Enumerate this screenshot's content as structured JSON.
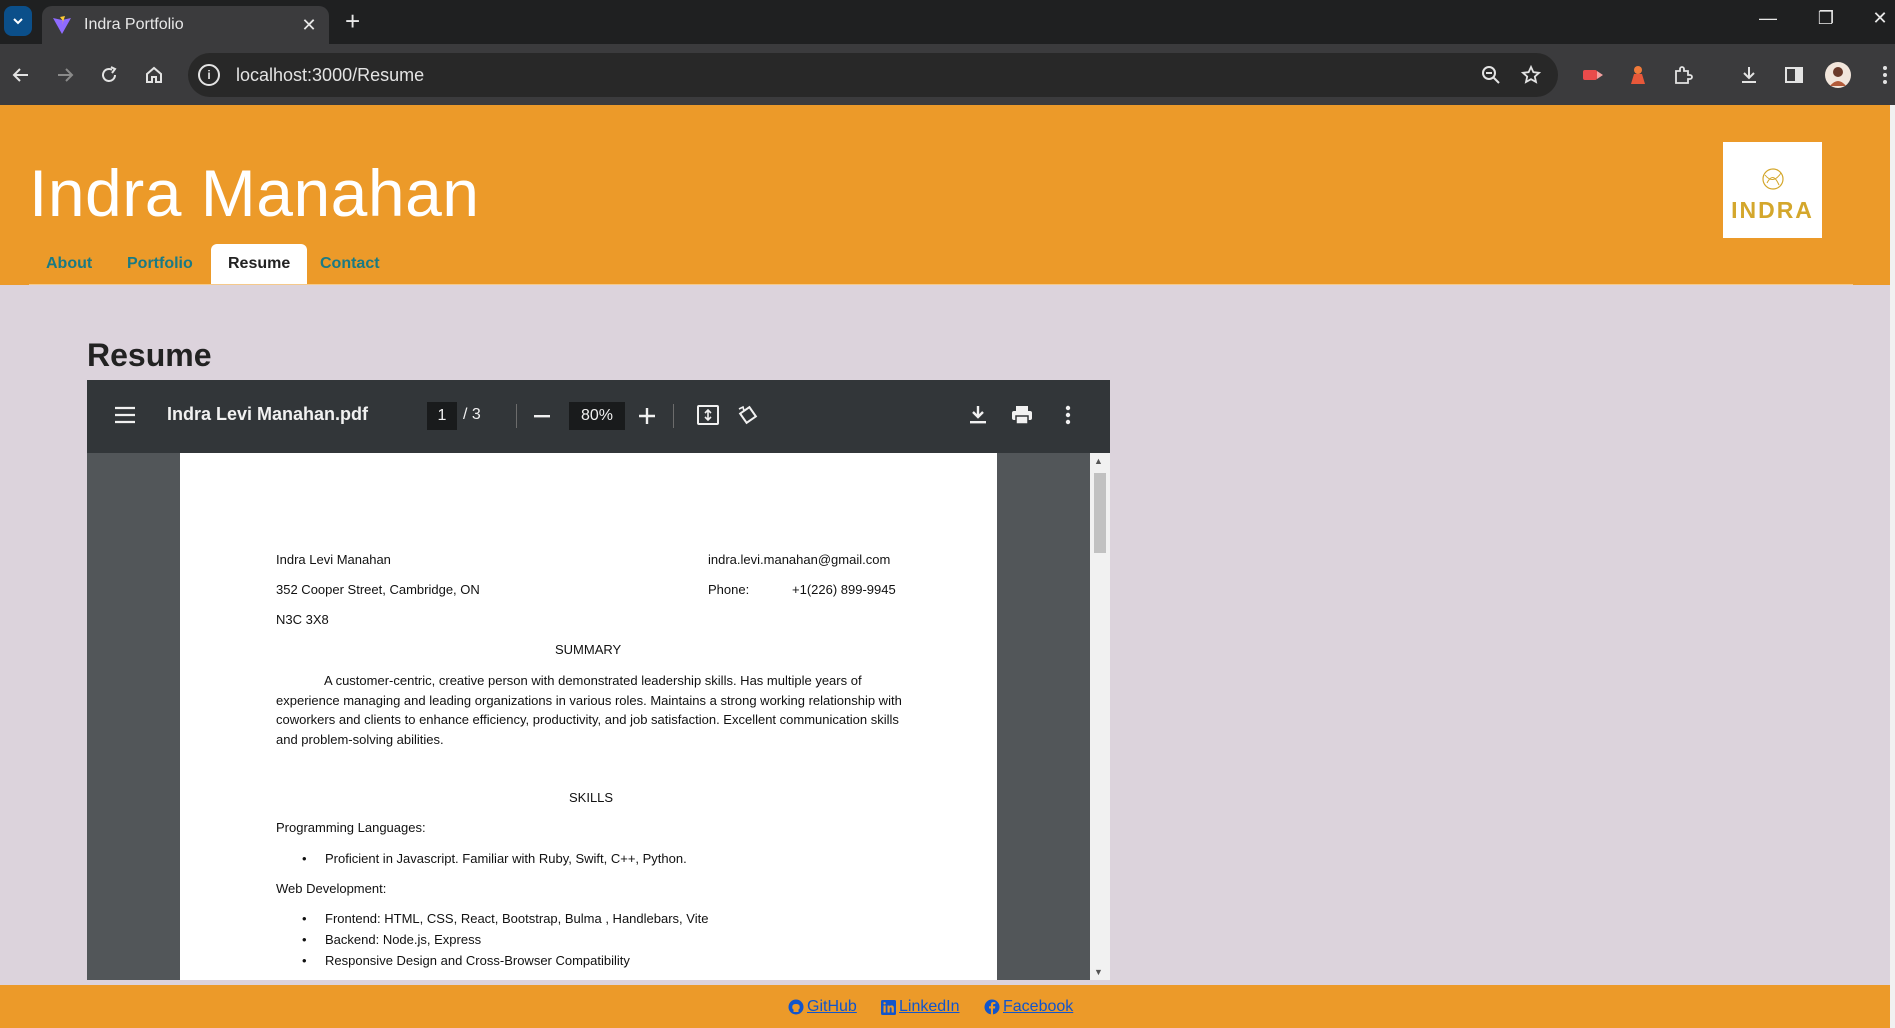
{
  "browser": {
    "tab_title": "Indra Portfolio",
    "url": "localhost:3000/Resume"
  },
  "site": {
    "title": "Indra Manahan",
    "logo_text": "INDRA",
    "nav": [
      {
        "label": "About"
      },
      {
        "label": "Portfolio"
      },
      {
        "label": "Resume",
        "active": true
      },
      {
        "label": "Contact"
      }
    ],
    "section_title": "Resume"
  },
  "pdf": {
    "filename": "Indra Levi Manahan.pdf",
    "page_current": "1",
    "page_total": "/  3",
    "zoom": "80%",
    "content": {
      "name": "Indra Levi Manahan",
      "email": "indra.levi.manahan@gmail.com",
      "address": "352 Cooper Street, Cambridge, ON",
      "phone_label": "Phone:",
      "phone": "+1(226) 899-9945",
      "postal": "N3C 3X8",
      "summary_heading": "SUMMARY",
      "summary": "A customer-centric, creative person with demonstrated leadership skills. Has multiple years of experience managing and leading organizations in various roles. Maintains a strong working relationship with coworkers and clients to enhance efficiency, productivity, and job satisfaction. Excellent communication skills and problem-solving abilities.",
      "skills_heading": "SKILLS",
      "prog_heading": "Programming Languages:",
      "prog_items": [
        "Proficient in Javascript. Familiar with Ruby, Swift, C++, Python."
      ],
      "web_heading": "Web Development:",
      "web_items": [
        "Frontend: HTML, CSS, React, Bootstrap, Bulma , Handlebars, Vite",
        "Backend: Node.js, Express",
        "Responsive Design and Cross-Browser Compatibility"
      ]
    }
  },
  "footer": {
    "links": [
      {
        "label": "GitHub",
        "icon": "github-icon"
      },
      {
        "label": "LinkedIn",
        "icon": "linkedin-icon"
      },
      {
        "label": "Facebook",
        "icon": "facebook-icon"
      }
    ]
  },
  "colors": {
    "header_bg": "#ec9a29",
    "page_bg": "#dcd3dc",
    "nav_link": "#1a7a84",
    "link": "#1155cc"
  }
}
